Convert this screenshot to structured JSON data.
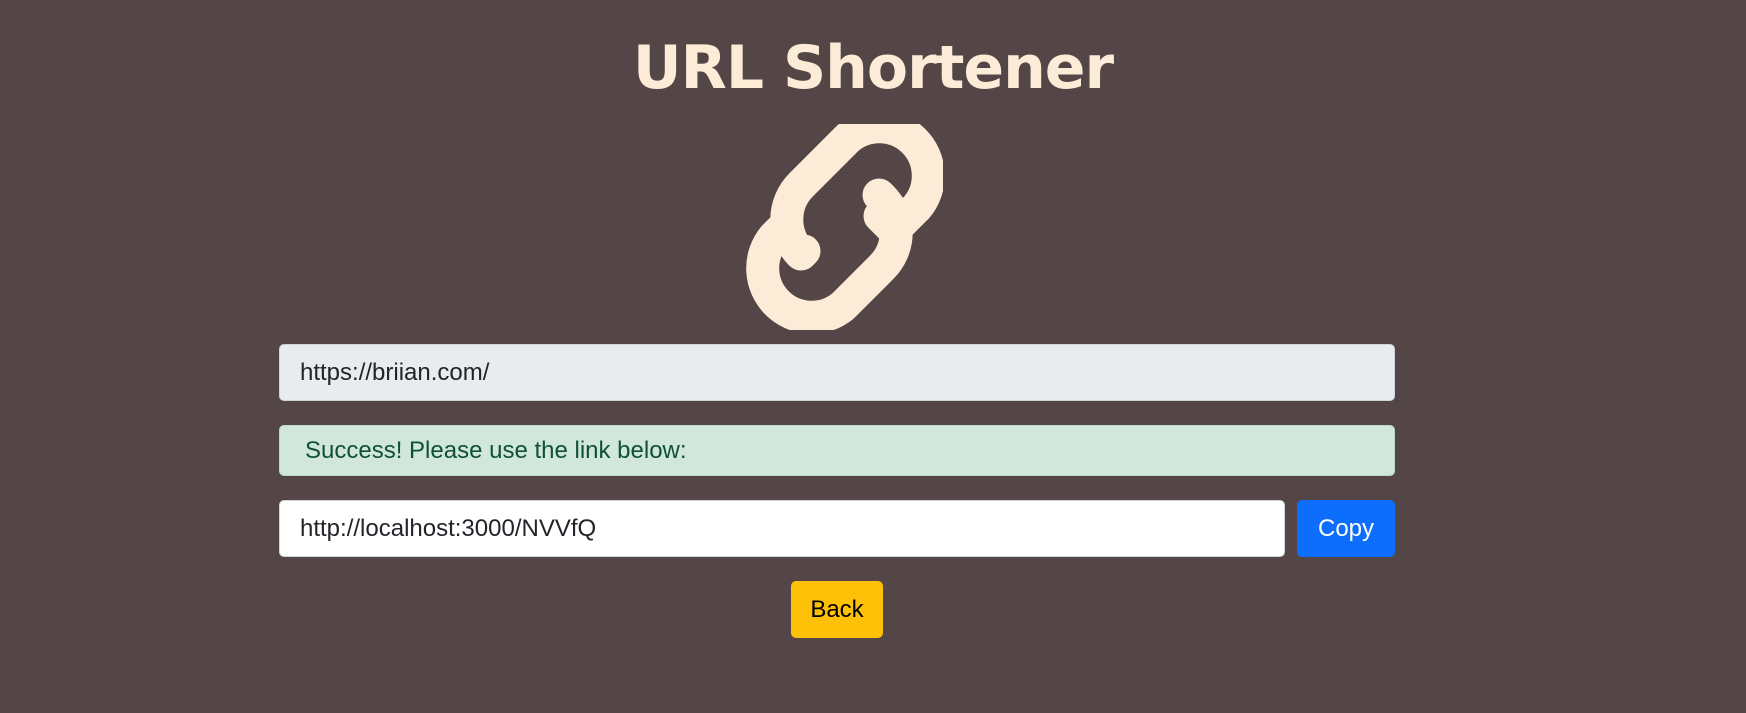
{
  "page": {
    "title": "URL Shortener",
    "logo_icon": "link-icon",
    "colors": {
      "background": "#544646",
      "accent": "#fbebd7",
      "success_bg": "#d1e7dd",
      "success_text": "#0f5132",
      "primary": "#0d6efd",
      "warning": "#ffc107"
    }
  },
  "form": {
    "original_url_value": "https://briian.com/",
    "alert_text": "Success! Please use the link below:",
    "short_url_value": "http://localhost:3000/NVVfQ",
    "copy_label": "Copy",
    "back_label": "Back"
  }
}
